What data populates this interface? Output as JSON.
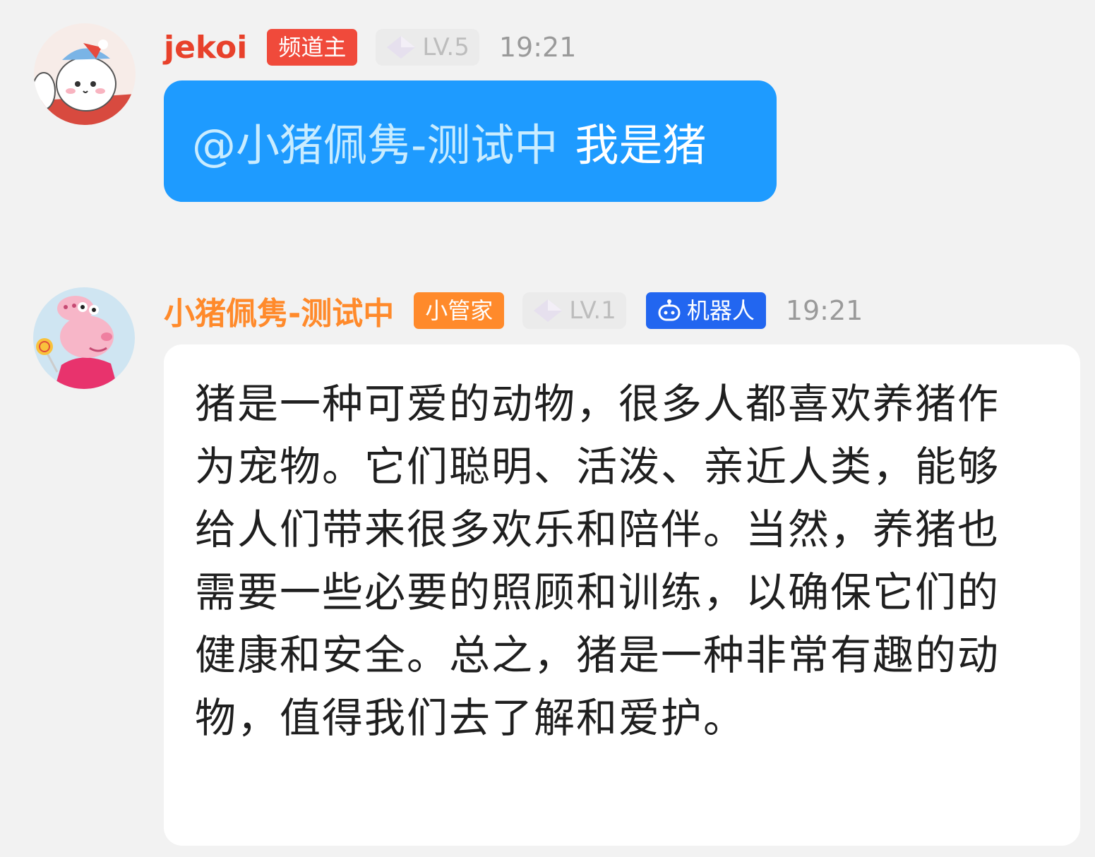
{
  "messages": [
    {
      "username": "jekoi",
      "role_badge": "频道主",
      "level": "LV.5",
      "time": "19:21",
      "mention": "@小猪佩隽-测试中",
      "text": "我是猪"
    },
    {
      "username": "小猪佩隽-测试中",
      "role_badge": "小管家",
      "level": "LV.1",
      "robot_badge": "机器人",
      "time": "19:21",
      "text": "猪是一种可爱的动物，很多人都喜欢养猪作为宠物。它们聪明、活泼、亲近人类，能够给人们带来很多欢乐和陪伴。当然，养猪也需要一些必要的照顾和训练，以确保它们的健康和安全。总之，猪是一种非常有趣的动物，值得我们去了解和爱护。"
    }
  ],
  "colors": {
    "owner_name": "#e8412b",
    "owner_badge": "#f04a3b",
    "bot_name": "#ff8a2b",
    "bot_badge": "#ff8a2b",
    "robot_badge": "#2266f0",
    "user_bubble": "#1e9bff"
  },
  "icons": [
    "cat-avatar-icon",
    "pig-avatar-icon",
    "level-diamond-icon",
    "robot-icon"
  ]
}
